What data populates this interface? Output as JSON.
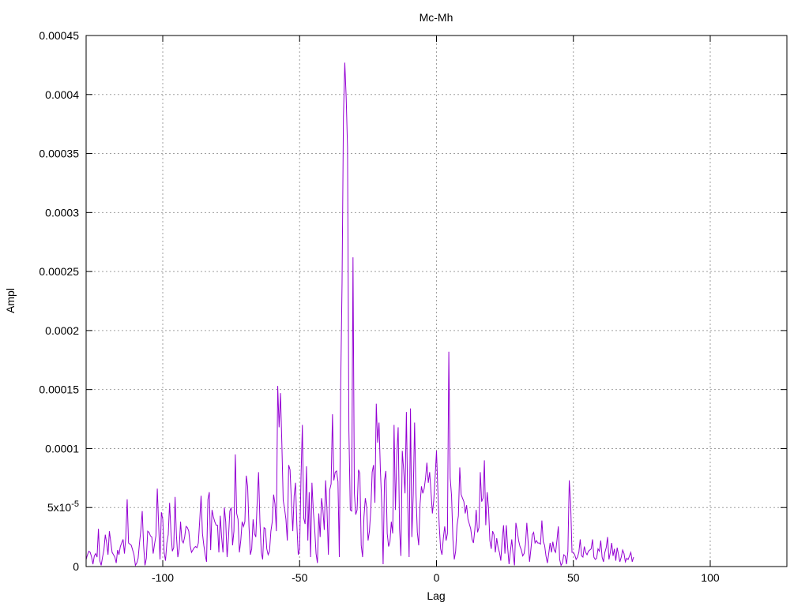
{
  "chart_data": {
    "type": "line",
    "title": "Mc-Mh",
    "xlabel": "Lag",
    "ylabel": "Ampl",
    "xlim": [
      -128,
      128
    ],
    "ylim": [
      0,
      0.00045
    ],
    "grid": true,
    "colors": {
      "series": "#9400d3",
      "grid": "#a0a0a0",
      "axis": "#000000"
    },
    "x_ticks": [
      {
        "value": -100,
        "label": "-100"
      },
      {
        "value": -50,
        "label": "-50"
      },
      {
        "value": 0,
        "label": "0"
      },
      {
        "value": 50,
        "label": "50"
      },
      {
        "value": 100,
        "label": "100"
      }
    ],
    "y_ticks": [
      {
        "value": 0,
        "label": "0"
      },
      {
        "value": 5e-05,
        "label": "5x10",
        "sup": "-5"
      },
      {
        "value": 0.0001,
        "label": "0.0001"
      },
      {
        "value": 0.00015,
        "label": "0.00015"
      },
      {
        "value": 0.0002,
        "label": "0.0002"
      },
      {
        "value": 0.00025,
        "label": "0.00025"
      },
      {
        "value": 0.0003,
        "label": "0.0003"
      },
      {
        "value": 0.00035,
        "label": "0.00035"
      },
      {
        "value": 0.0004,
        "label": "0.0004"
      },
      {
        "value": 0.00045,
        "label": "0.00045"
      }
    ],
    "series": [
      {
        "x_start": -128,
        "x_step": 0.5,
        "values": [
          6e-06,
          1e-05,
          1.3e-05,
          1.2e-05,
          8e-06,
          2e-06,
          9e-06,
          1.1e-05,
          8e-06,
          3.2e-05,
          5e-06,
          1e-06,
          8e-06,
          1.4e-05,
          2.7e-05,
          2e-05,
          1e-05,
          3e-05,
          2.1e-05,
          1.2e-05,
          1e-05,
          8e-06,
          3e-06,
          1.4e-05,
          1e-05,
          1.7e-05,
          2e-05,
          2.3e-05,
          1.1e-05,
          2.5e-05,
          5.7e-05,
          2e-05,
          1.9e-05,
          1.8e-05,
          1.4e-05,
          1e-05,
          1e-06,
          3e-06,
          7e-06,
          2e-05,
          3.1e-05,
          4.7e-05,
          1.8e-05,
          1e-06,
          7e-06,
          3e-05,
          2.9e-05,
          2.6e-05,
          2.5e-05,
          1.1e-05,
          1.9e-05,
          2.6e-05,
          6.6e-05,
          3.5e-05,
          6e-06,
          4.6e-05,
          4e-05,
          1.2e-05,
          5e-06,
          2e-05,
          2.7e-05,
          5.4e-05,
          2.9e-05,
          1.3e-05,
          1.6e-05,
          5.9e-05,
          2.6e-05,
          8e-06,
          1.5e-05,
          3.8e-05,
          2.2e-05,
          2e-05,
          2.5e-05,
          3.4e-05,
          3.3e-05,
          3e-05,
          1.8e-05,
          1.2e-05,
          1.4e-05,
          1.6e-05,
          1.7e-05,
          1.6e-05,
          2e-05,
          3.9e-05,
          6e-05,
          2.8e-05,
          1.8e-05,
          1e-05,
          4e-06,
          5.7e-05,
          6.3e-05,
          1.4e-05,
          4.8e-05,
          4.2e-05,
          3.8e-05,
          3.5e-05,
          3.5e-05,
          1.2e-05,
          4.3e-05,
          2.5e-05,
          1.2e-05,
          5e-05,
          3.8e-05,
          8e-06,
          2.4e-05,
          4.7e-05,
          5e-05,
          1.8e-05,
          3e-05,
          9.5e-05,
          4.5e-05,
          4e-05,
          1.2e-05,
          2.2e-05,
          3.8e-05,
          3.4e-05,
          3.8e-05,
          7.7e-05,
          6.8e-05,
          3.4e-05,
          1e-05,
          1.5e-05,
          4e-05,
          2.8e-05,
          2.5e-05,
          5.5e-05,
          8e-05,
          3.8e-05,
          1.2e-05,
          6e-06,
          3.3e-05,
          3.2e-05,
          1.5e-05,
          1e-05,
          1.3e-05,
          3e-05,
          3.8e-05,
          6.1e-05,
          5.3e-05,
          3e-05,
          0.000153,
          0.000118,
          0.000147,
          0.000105,
          5.6e-05,
          4.9e-05,
          4e-05,
          2.2e-05,
          8.6e-05,
          8.2e-05,
          5.5e-05,
          3e-05,
          6e-05,
          7.1e-05,
          3.5e-05,
          1e-05,
          1.5e-05,
          7.5e-05,
          0.00012,
          4.1e-05,
          3.6e-05,
          8.5e-05,
          2.2e-05,
          6.3e-05,
          8e-06,
          7.1e-05,
          4.7e-05,
          3.2e-05,
          1.1e-05,
          3e-06,
          4.5e-05,
          2.5e-05,
          5.8e-05,
          4.8e-05,
          3.1e-05,
          7.3e-05,
          4.8e-05,
          1e-05,
          6.5e-05,
          7e-05,
          0.000129,
          7.3e-05,
          8e-05,
          8.1e-05,
          7.2e-05,
          8e-06,
          0.000152,
          0.00024,
          0.000381,
          0.000427,
          0.000398,
          0.000355,
          0.000115,
          4.8e-05,
          4.7e-05,
          0.000262,
          6.2e-05,
          4.4e-05,
          4.8e-05,
          8.2e-05,
          7.9e-05,
          1.8e-05,
          8e-06,
          4.2e-05,
          5.8e-05,
          5e-05,
          2.2e-05,
          3e-05,
          4.8e-05,
          8e-05,
          8.6e-05,
          5.4e-05,
          0.000138,
          0.000105,
          0.000122,
          8.2e-05,
          5.3e-05,
          2e-06,
          7.3e-05,
          8.1e-05,
          2.8e-05,
          1.7e-05,
          2.1e-05,
          3.8e-05,
          2.8e-05,
          0.00012,
          4.8e-05,
          9.5e-05,
          0.000118,
          3.2e-05,
          9e-06,
          9.8e-05,
          8.2e-05,
          6.2e-05,
          0.000131,
          5.3e-05,
          8e-06,
          0.000134,
          2.5e-05,
          6.1e-05,
          0.000122,
          6.2e-05,
          2.9e-05,
          1.8e-05,
          5.3e-05,
          6.8e-05,
          6.2e-05,
          6.6e-05,
          7.5e-05,
          8.8e-05,
          7.1e-05,
          8e-05,
          6.3e-05,
          4.5e-05,
          5.6e-05,
          7.6e-05,
          9.8e-05,
          6.4e-05,
          3.5e-05,
          1.5e-05,
          1e-05,
          2.4e-05,
          3.4e-05,
          2.2e-05,
          2.8e-05,
          0.000182,
          7.5e-05,
          6e-05,
          2.3e-05,
          6e-06,
          1.3e-05,
          3.5e-05,
          4.3e-05,
          8.4e-05,
          6.1e-05,
          5.8e-05,
          5.5e-05,
          4.5e-05,
          5.2e-05,
          4e-05,
          3.6e-05,
          3.2e-05,
          2.3e-05,
          2e-05,
          3.1e-05,
          4.8e-05,
          2.9e-05,
          3.3e-05,
          8e-05,
          5.5e-05,
          5.8e-05,
          9e-05,
          3.5e-05,
          6.3e-05,
          5e-05,
          2.2e-05,
          1.5e-05,
          3e-05,
          2.7e-05,
          1.2e-05,
          2.4e-05,
          1.6e-05,
          1.2e-05,
          5e-06,
          2.3e-05,
          3.5e-05,
          1.1e-05,
          3.5e-05,
          1.6e-05,
          2e-06,
          1.3e-05,
          2.3e-05,
          1e-05,
          1e-06,
          3.7e-05,
          3e-05,
          2.2e-05,
          1.7e-05,
          1.4e-05,
          9e-06,
          1.1e-05,
          1.9e-05,
          3.7e-05,
          2e-05,
          4e-06,
          1.5e-05,
          2.7e-05,
          2.9e-05,
          2e-05,
          2.2e-05,
          2e-05,
          2e-05,
          1.9e-05,
          3.9e-05,
          2.1e-05,
          1.8e-05,
          9e-06,
          3e-06,
          1.1e-05,
          2e-05,
          1.2e-05,
          2.1e-05,
          1.4e-05,
          1.2e-05,
          2.2e-05,
          3.4e-05,
          6e-06,
          1e-06,
          3e-06,
          1e-05,
          9e-06,
          2e-06,
          1.3e-05,
          7.3e-05,
          5.4e-05,
          1.2e-05,
          1.2e-05,
          1e-05,
          6e-06,
          8e-06,
          1.2e-05,
          2.3e-05,
          9e-06,
          8e-06,
          1.7e-05,
          1.2e-05,
          1e-05,
          1.3e-05,
          1.4e-05,
          1.5e-05,
          2.3e-05,
          8e-06,
          6e-06,
          7e-06,
          1.5e-05,
          1.3e-05,
          2.2e-05,
          8e-06,
          4e-06,
          1.2e-05,
          1.6e-05,
          2.5e-05,
          6e-06,
          1.2e-05,
          2e-05,
          9e-06,
          1.5e-05,
          5e-06,
          1.6e-05,
          1e-05,
          4e-06,
          8e-06,
          1.4e-05,
          1.1e-05,
          4e-06,
          7e-06,
          6e-06,
          9e-06,
          1.2e-05,
          4e-06,
          8e-06
        ]
      }
    ]
  }
}
